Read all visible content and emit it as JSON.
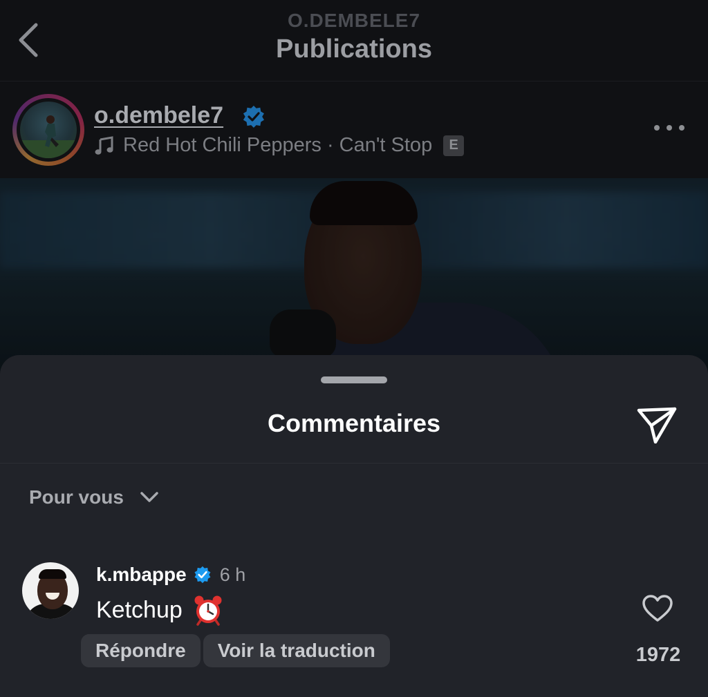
{
  "header": {
    "subtitle": "O.DEMBELE7",
    "title": "Publications"
  },
  "post": {
    "author": "o.dembele7",
    "audio": "Red Hot Chili Peppers · Can't Stop",
    "explicit_badge": "E"
  },
  "comments_sheet": {
    "title": "Commentaires",
    "filter_label": "Pour vous",
    "comments": [
      {
        "username": "k.mbappe",
        "time": "6 h",
        "text": "Ketchup",
        "reply_label": "Répondre",
        "translate_label": "Voir la traduction",
        "likes": "1972"
      }
    ]
  },
  "icons": {
    "back": "chevron-left-icon",
    "verified": "verified-badge-icon",
    "music": "music-note-icon",
    "more": "more-options-icon",
    "share": "paper-plane-icon",
    "filter": "chevron-down-icon",
    "emoji": "alarm-clock-icon",
    "like": "heart-icon"
  },
  "colors": {
    "sheet_background": "#212329",
    "verified_blue": "#1d9bf0",
    "alarm_red": "#e0322f"
  }
}
